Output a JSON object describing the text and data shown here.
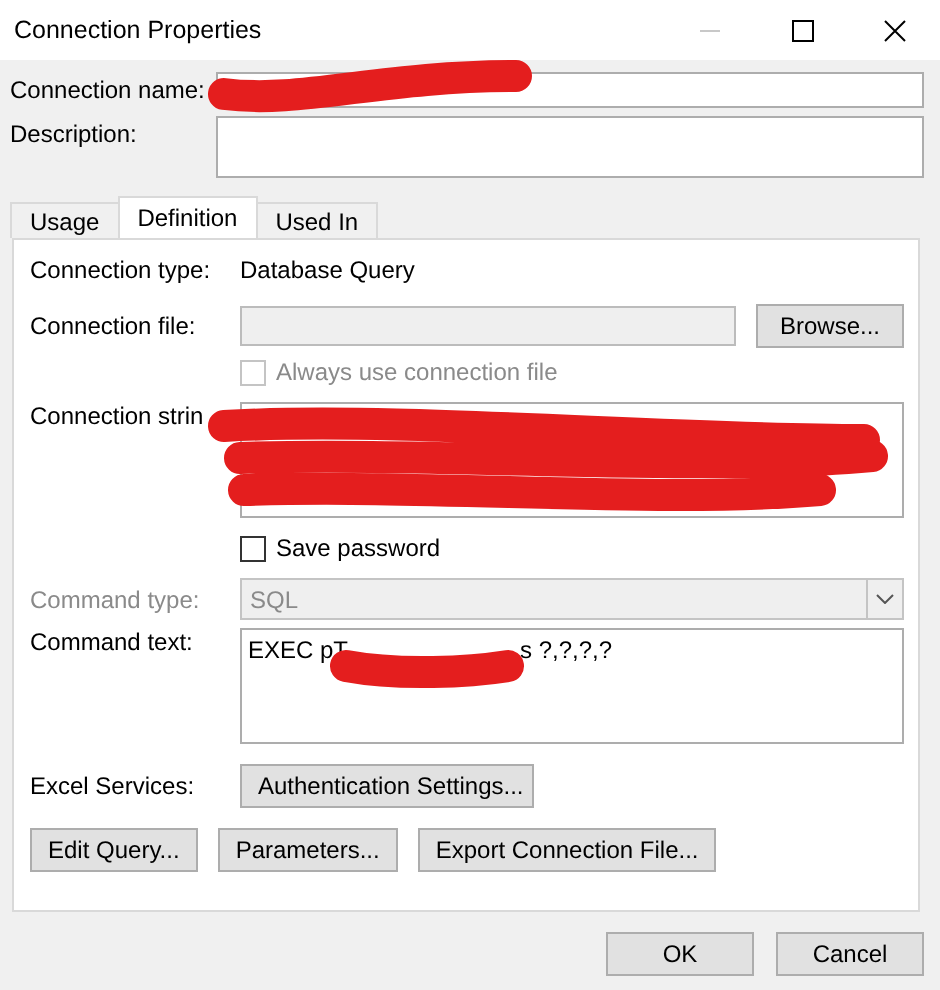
{
  "window": {
    "title": "Connection Properties"
  },
  "connection_name": {
    "label": "Connection name:"
  },
  "description": {
    "label": "Description:"
  },
  "tabs": [
    {
      "label": "Usage",
      "selected": false
    },
    {
      "label": "Definition",
      "selected": true
    },
    {
      "label": "Used In",
      "selected": false
    }
  ],
  "definition": {
    "connection_type": {
      "label": "Connection type:",
      "value": "Database Query"
    },
    "connection_file": {
      "label": "Connection file:",
      "disabled": true,
      "button": "Browse..."
    },
    "always_use_file": {
      "label": "Always use connection file",
      "checked": false,
      "disabled": true
    },
    "connection_string": {
      "label": "Connection strin"
    },
    "save_password": {
      "label": "Save password",
      "checked": false
    },
    "command_type": {
      "label": "Command type:",
      "value": "SQL",
      "disabled": true
    },
    "command_text": {
      "label": "Command text:",
      "fragments": [
        "EXEC pT",
        "s ?,?,?,?"
      ]
    },
    "excel_services": {
      "label": "Excel Services:",
      "button": "Authentication Settings..."
    },
    "buttons": [
      "Edit Query...",
      "Parameters...",
      "Export Connection File..."
    ]
  },
  "buttons": [
    "OK",
    "Cancel"
  ]
}
